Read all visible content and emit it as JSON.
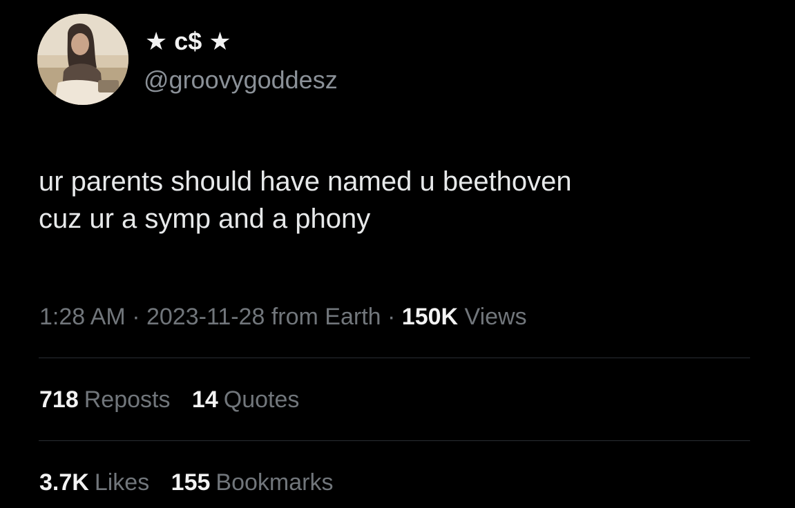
{
  "profile": {
    "display_name": "★ c$ ★",
    "handle": "@groovygoddesz"
  },
  "tweet": {
    "text_lines": [
      "ur parents should have named u beethoven",
      "cuz ur a symp and a phony"
    ]
  },
  "meta": {
    "time": "1:28 AM",
    "separator": "·",
    "date": "2023-11-28",
    "source": "from Earth",
    "views_count": "150K",
    "views_label": "Views"
  },
  "stats": {
    "reposts_count": "718",
    "reposts_label": "Reposts",
    "quotes_count": "14",
    "quotes_label": "Quotes",
    "likes_count": "3.7K",
    "likes_label": "Likes",
    "bookmarks_count": "155",
    "bookmarks_label": "Bookmarks"
  },
  "colors": {
    "background": "#000000",
    "primary_text": "#e7e9ea",
    "secondary_text": "#71767b",
    "divider": "#2a2e33"
  }
}
